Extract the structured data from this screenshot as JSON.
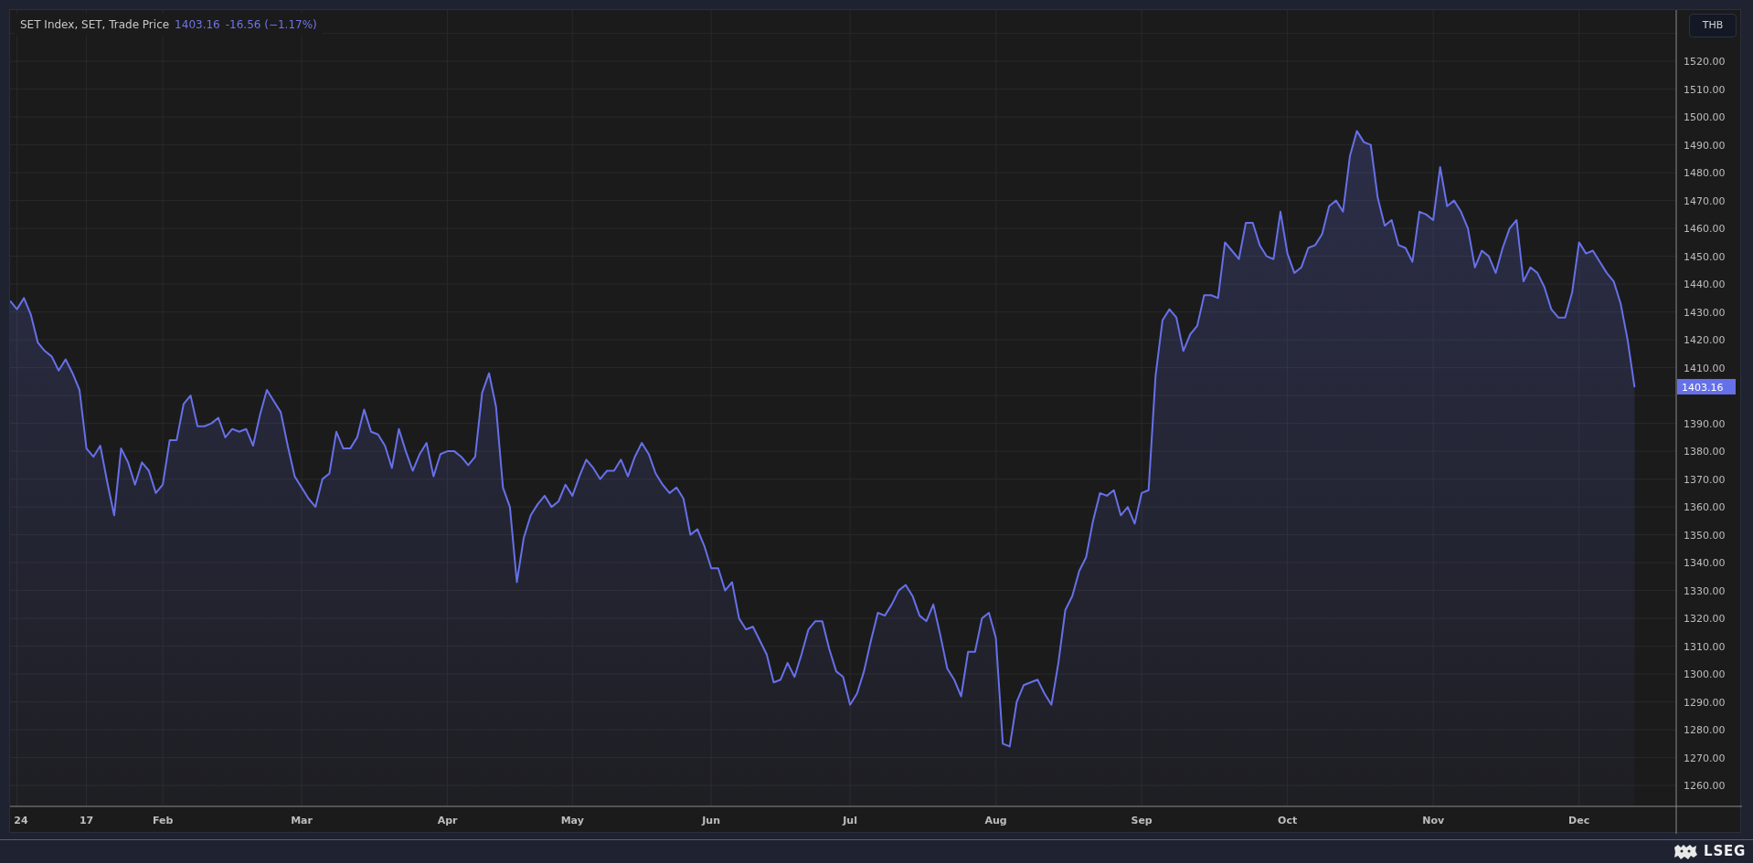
{
  "legend": {
    "title": "SET Index, SET, Trade Price",
    "price": "1403.16",
    "change": "-16.56 (−1.17%)"
  },
  "currency_button": {
    "label": "THB"
  },
  "chart_data": {
    "type": "area",
    "grid": true,
    "ylim": [
      1252.5,
      1538.4
    ],
    "categories": [
      null,
      "24",
      null,
      null,
      null,
      null,
      null,
      null,
      null,
      null,
      null,
      "17",
      null,
      null,
      null,
      null,
      null,
      null,
      null,
      null,
      null,
      null,
      "Feb",
      null,
      null,
      null,
      null,
      null,
      null,
      null,
      null,
      null,
      null,
      null,
      null,
      null,
      null,
      null,
      null,
      null,
      null,
      null,
      "Mar",
      null,
      null,
      null,
      null,
      null,
      null,
      null,
      null,
      null,
      null,
      null,
      null,
      null,
      null,
      null,
      null,
      null,
      null,
      null,
      null,
      "Apr",
      null,
      null,
      null,
      null,
      null,
      null,
      null,
      null,
      null,
      null,
      null,
      null,
      null,
      null,
      null,
      null,
      null,
      "May",
      null,
      null,
      null,
      null,
      null,
      null,
      null,
      null,
      null,
      null,
      null,
      null,
      null,
      null,
      null,
      null,
      null,
      null,
      null,
      "Jun",
      null,
      null,
      null,
      null,
      null,
      null,
      null,
      null,
      null,
      null,
      null,
      null,
      null,
      null,
      null,
      null,
      null,
      null,
      null,
      "Jul",
      null,
      null,
      null,
      null,
      null,
      null,
      null,
      null,
      null,
      null,
      null,
      null,
      null,
      null,
      null,
      null,
      null,
      null,
      null,
      null,
      "Aug",
      null,
      null,
      null,
      null,
      null,
      null,
      null,
      null,
      null,
      null,
      null,
      null,
      null,
      null,
      null,
      null,
      null,
      null,
      null,
      null,
      "Sep",
      null,
      null,
      null,
      null,
      null,
      null,
      null,
      null,
      null,
      null,
      null,
      null,
      null,
      null,
      null,
      null,
      null,
      null,
      null,
      null,
      "Oct",
      null,
      null,
      null,
      null,
      null,
      null,
      null,
      null,
      null,
      null,
      null,
      null,
      null,
      null,
      null,
      null,
      null,
      null,
      null,
      null,
      "Nov",
      null,
      null,
      null,
      null,
      null,
      null,
      null,
      null,
      null,
      null,
      null,
      null,
      null,
      null,
      null,
      null,
      null,
      null,
      null,
      null,
      "Dec",
      null,
      null,
      null,
      null,
      null,
      null,
      null,
      null
    ],
    "yticks": [
      {
        "value": 1260,
        "label": "1260.00"
      },
      {
        "value": 1270,
        "label": "1270.00"
      },
      {
        "value": 1280,
        "label": "1280.00"
      },
      {
        "value": 1290,
        "label": "1290.00"
      },
      {
        "value": 1300,
        "label": "1300.00"
      },
      {
        "value": 1310,
        "label": "1310.00"
      },
      {
        "value": 1320,
        "label": "1320.00"
      },
      {
        "value": 1330,
        "label": "1330.00"
      },
      {
        "value": 1340,
        "label": "1340.00"
      },
      {
        "value": 1350,
        "label": "1350.00"
      },
      {
        "value": 1360,
        "label": "1360.00"
      },
      {
        "value": 1370,
        "label": "1370.00"
      },
      {
        "value": 1380,
        "label": "1380.00"
      },
      {
        "value": 1390,
        "label": "1390.00"
      },
      {
        "value": 1410,
        "label": "1410.00"
      },
      {
        "value": 1420,
        "label": "1420.00"
      },
      {
        "value": 1430,
        "label": "1430.00"
      },
      {
        "value": 1440,
        "label": "1440.00"
      },
      {
        "value": 1450,
        "label": "1450.00"
      },
      {
        "value": 1460,
        "label": "1460.00"
      },
      {
        "value": 1470,
        "label": "1470.00"
      },
      {
        "value": 1480,
        "label": "1480.00"
      },
      {
        "value": 1490,
        "label": "1490.00"
      },
      {
        "value": 1500,
        "label": "1500.00"
      },
      {
        "value": 1510,
        "label": "1510.00"
      },
      {
        "value": 1520,
        "label": "1520.00"
      }
    ],
    "series": [
      {
        "color": "#6670e8",
        "values": [
          1434,
          1431,
          1435,
          1429,
          1419,
          1416,
          1414,
          1409,
          1413,
          1408,
          1402,
          1381,
          1378,
          1382,
          1369,
          1357,
          1381,
          1376,
          1368,
          1376,
          1373,
          1365,
          1368,
          1384,
          1384,
          1397,
          1400,
          1389,
          1389,
          1390,
          1392,
          1385,
          1388,
          1387,
          1388,
          1382,
          1393,
          1402,
          1398,
          1394,
          1382,
          1371,
          1367,
          1363,
          1360,
          1370,
          1372,
          1387,
          1381,
          1381,
          1385,
          1395,
          1387,
          1386,
          1382,
          1374,
          1388,
          1380,
          1373,
          1379,
          1383,
          1371,
          1379,
          1380,
          1380,
          1378,
          1375,
          1378,
          1401,
          1408,
          1396,
          1367,
          1360,
          1333,
          1349,
          1357,
          1361,
          1364,
          1360,
          1362,
          1368,
          1364,
          1371,
          1377,
          1374,
          1370,
          1373,
          1373,
          1377,
          1371,
          1378,
          1383,
          1379,
          1372,
          1368,
          1365,
          1367,
          1363,
          1350,
          1352,
          1346,
          1338,
          1338,
          1330,
          1333,
          1320,
          1316,
          1317,
          1312,
          1307,
          1297,
          1298,
          1304,
          1299,
          1307,
          1316,
          1319,
          1319,
          1309,
          1301,
          1299,
          1289,
          1293,
          1301,
          1312,
          1322,
          1321,
          1325,
          1330,
          1332,
          1328,
          1321,
          1319,
          1325,
          1314,
          1302,
          1298,
          1292,
          1308,
          1308,
          1320,
          1322,
          1313,
          1275,
          1274,
          1290,
          1296,
          1297,
          1298,
          1293,
          1289,
          1304,
          1323,
          1328,
          1337,
          1342,
          1355,
          1365,
          1364,
          1366,
          1357,
          1360,
          1354,
          1365,
          1366,
          1407,
          1427,
          1431,
          1428,
          1416,
          1422,
          1425,
          1436,
          1436,
          1435,
          1455,
          1452,
          1449,
          1462,
          1462,
          1454,
          1450,
          1449,
          1466,
          1451,
          1444,
          1446,
          1453,
          1454,
          1458,
          1468,
          1470,
          1466,
          1486,
          1495,
          1491,
          1490,
          1471,
          1461,
          1463,
          1454,
          1453,
          1448,
          1466,
          1465,
          1463,
          1482,
          1468,
          1470,
          1466,
          1460,
          1446,
          1452,
          1450,
          1444,
          1453,
          1460,
          1463,
          1441,
          1446,
          1444,
          1439,
          1431,
          1428,
          1428,
          1437,
          1455,
          1451,
          1452,
          1448,
          1444,
          1441,
          1433,
          1420,
          1403
        ]
      }
    ]
  },
  "last_price_label": "1403.16",
  "footer": {
    "logo_text": "LSEG"
  }
}
